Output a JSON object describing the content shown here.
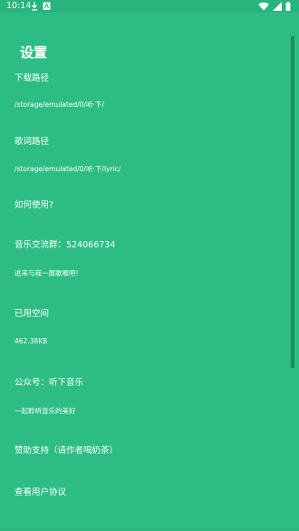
{
  "status_bar": {
    "time": "10:14",
    "icons_left": [
      "download-icon",
      "notification-app-icon"
    ],
    "icons_right": [
      "wifi-icon",
      "signal-icon",
      "battery-icon"
    ]
  },
  "page": {
    "title": "设置"
  },
  "settings": {
    "download_path": {
      "title": "下载路径",
      "value": "/storage/emulated/0/听·下/"
    },
    "lyric_path": {
      "title": "歌词路径",
      "value": "/storage/emulated/0/听·下/lyric/"
    },
    "how_to_use": {
      "title": "如何使用?"
    },
    "music_group": {
      "title": "音乐交流群：524066734",
      "value": "进来与我一展歌喉吧!"
    },
    "used_space": {
      "title": "已用空间",
      "value": "462.38KB"
    },
    "official_account": {
      "title": "公众号：听下音乐",
      "value": "一起聆听音乐的美好"
    },
    "sponsor": {
      "title": "赞助支持（请作者喝奶茶）"
    },
    "user_agreement": {
      "title": "查看用户协议"
    }
  },
  "colors": {
    "background": "#2dbd84",
    "status_bar": "#27b57d",
    "text": "#ffffff",
    "scrollbar": "#1e8a5f"
  }
}
